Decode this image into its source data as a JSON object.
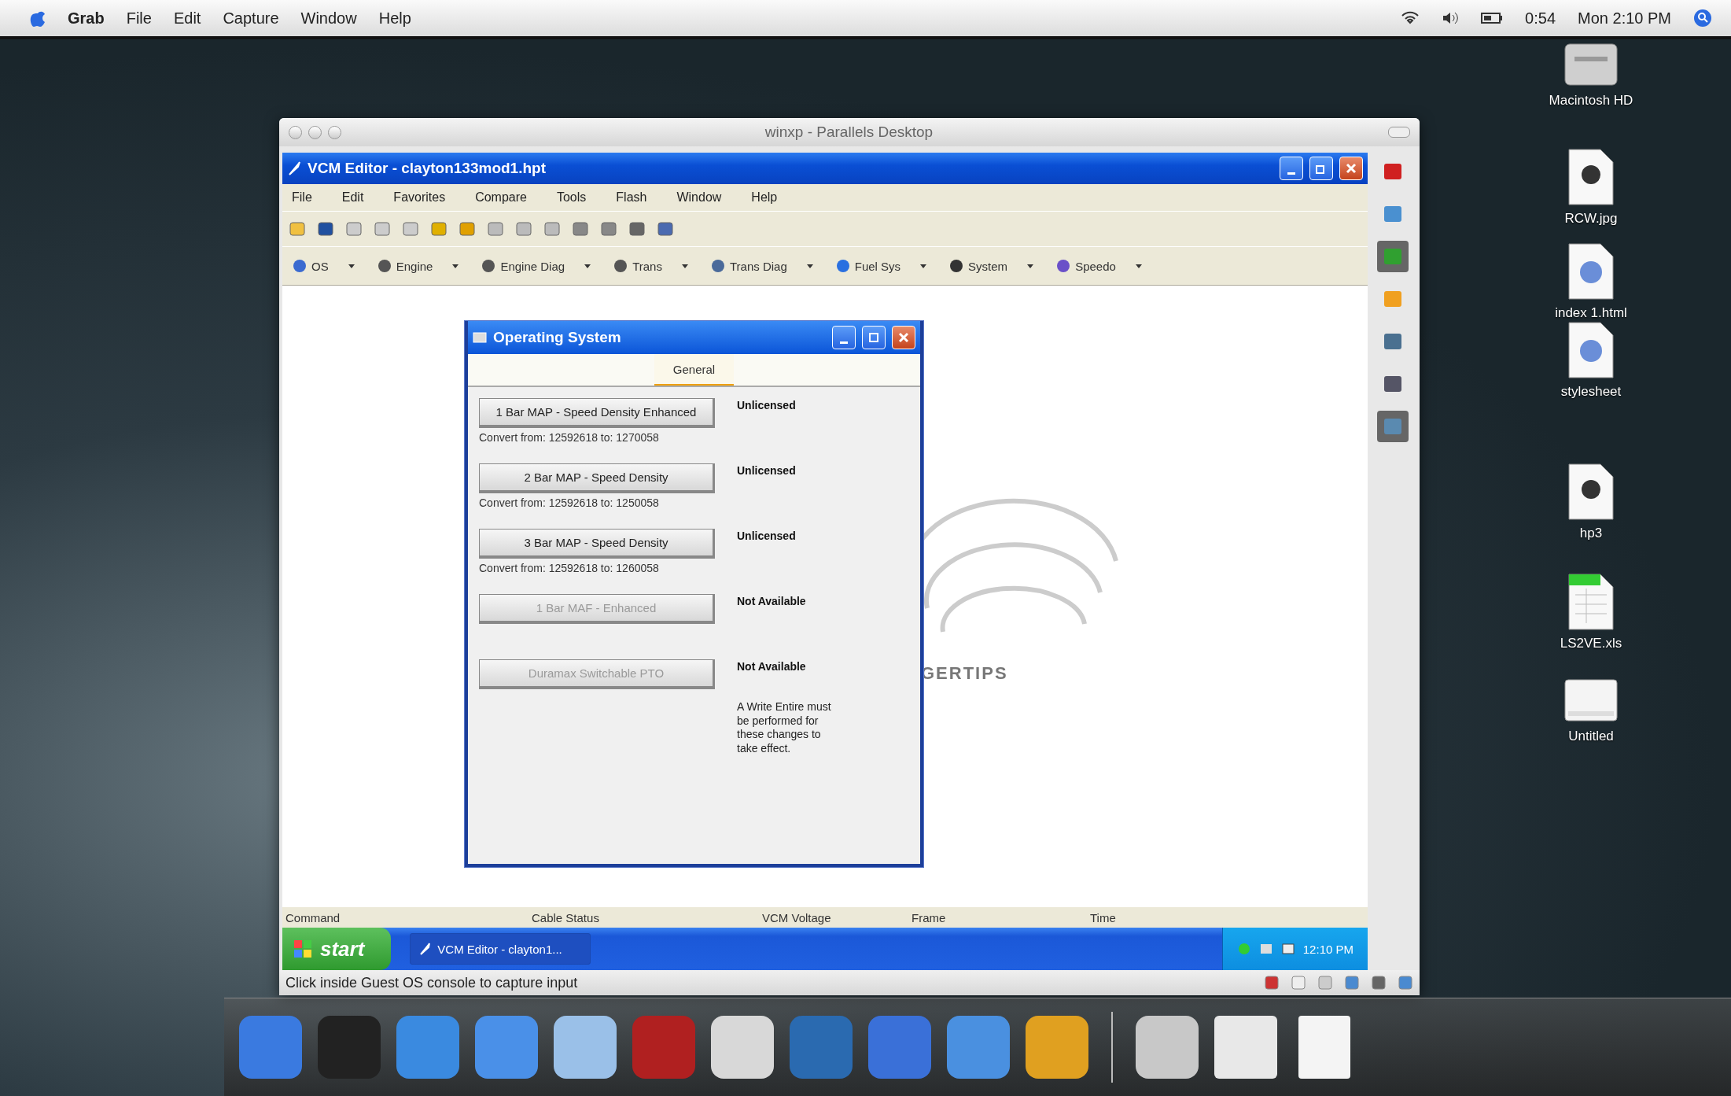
{
  "mac_menubar": {
    "app": "Grab",
    "menus": [
      "File",
      "Edit",
      "Capture",
      "Window",
      "Help"
    ],
    "battery": "0:54",
    "clock": "Mon 2:10 PM"
  },
  "parallels": {
    "title": "winxp - Parallels Desktop",
    "status": "Click inside Guest OS console to capture input"
  },
  "vcm_editor": {
    "title": "VCM Editor - clayton133mod1.hpt",
    "menus": [
      "File",
      "Edit",
      "Favorites",
      "Compare",
      "Tools",
      "Flash",
      "Window",
      "Help"
    ],
    "modules": [
      {
        "label": "OS"
      },
      {
        "label": "Engine"
      },
      {
        "label": "Engine Diag"
      },
      {
        "label": "Trans"
      },
      {
        "label": "Trans Diag"
      },
      {
        "label": "Fuel Sys"
      },
      {
        "label": "System"
      },
      {
        "label": "Speedo"
      }
    ],
    "logo_text": "GERTIPS",
    "status_columns": [
      "Command",
      "Cable Status",
      "VCM Voltage",
      "Frame",
      "Time"
    ]
  },
  "dialog": {
    "title": "Operating System",
    "tabs": [
      {
        "label": "General",
        "selected": true
      }
    ],
    "options": [
      {
        "label": "1 Bar MAP - Speed Density Enhanced",
        "disabled": false,
        "convert": "Convert from: 12592618 to: 1270058",
        "status": "Unlicensed"
      },
      {
        "label": "2 Bar MAP - Speed Density",
        "disabled": false,
        "convert": "Convert from: 12592618 to: 1250058",
        "status": "Unlicensed"
      },
      {
        "label": "3 Bar MAP - Speed Density",
        "disabled": false,
        "convert": "Convert from: 12592618 to: 1260058",
        "status": "Unlicensed"
      },
      {
        "label": "1 Bar MAF - Enhanced",
        "disabled": true,
        "status": "Not Available"
      },
      {
        "label": "Duramax Switchable PTO",
        "disabled": true,
        "status": "Not Available"
      }
    ],
    "note": "A Write Entire must be performed for these changes to take effect."
  },
  "taskbar": {
    "start": "start",
    "tasks": [
      {
        "label": "VCM Editor - clayton1...",
        "selected": true
      }
    ],
    "clock": "12:10 PM"
  },
  "desktop_icons": [
    {
      "label": "Macintosh HD",
      "kind": "drive"
    },
    {
      "label": "RCW.jpg",
      "kind": "image"
    },
    {
      "label": "index 1.html",
      "kind": "web"
    },
    {
      "label": "stylesheet",
      "kind": "web"
    },
    {
      "label": "hp3",
      "kind": "image"
    },
    {
      "label": "LS2VE.xls",
      "kind": "sheet"
    },
    {
      "label": "Untitled",
      "kind": "blank"
    }
  ]
}
